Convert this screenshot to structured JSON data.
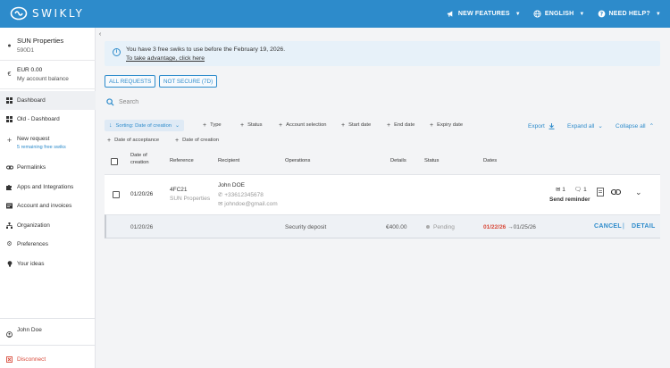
{
  "brand": {
    "name": "SWIKLY",
    "color": "#2d8bcb"
  },
  "topnav": [
    {
      "label": "NEW FEATURES",
      "icon": "megaphone-icon"
    },
    {
      "label": "ENGLISH",
      "icon": "globe-icon"
    },
    {
      "label": "NEED HELP?",
      "icon": "help-icon"
    }
  ],
  "sidebar": {
    "company_name": "SUN Properties",
    "company_code": "590D1",
    "balance_amount": "EUR 0.00",
    "balance_label": "My account balance",
    "items": [
      {
        "label": "Dashboard",
        "icon": "grid-icon",
        "active": true
      },
      {
        "label": "Old - Dashboard",
        "icon": "grid-icon"
      },
      {
        "label": "New request",
        "icon": "plus-icon",
        "sub": "5 remaining free swiks"
      },
      {
        "label": "Permalinks",
        "icon": "link-icon"
      },
      {
        "label": "Apps and Integrations",
        "icon": "puzzle-icon"
      },
      {
        "label": "Account and invoices",
        "icon": "invoice-icon"
      },
      {
        "label": "Organization",
        "icon": "org-chart-icon"
      },
      {
        "label": "Preferences",
        "icon": "gear-icon"
      },
      {
        "label": "Your ideas",
        "icon": "lightbulb-icon"
      }
    ],
    "user_name": "John Doe",
    "logout_label": "Disconnect"
  },
  "banner": {
    "message": "You have 3 free swiks to use before the February 19, 2026.",
    "link": "To take advantage, click here"
  },
  "filters": {
    "all_requests": "ALL REQUESTS",
    "not_secure": "NOT SECURE (7D)"
  },
  "search": {
    "placeholder": "Search"
  },
  "chips": {
    "sorting": "Sorting: Date of creation",
    "type": "Type",
    "status": "Status",
    "account_selection": "Account selection",
    "start_date": "Start date",
    "end_date": "End date",
    "expiry_date": "Expiry date",
    "date_of_acceptance": "Date of acceptance",
    "date_of_creation": "Date of creation"
  },
  "actions": {
    "export": "Export",
    "expand_all": "Expand all",
    "collapse_all": "Collapse all"
  },
  "table": {
    "headers": {
      "date_of_creation_1": "Date of",
      "date_of_creation_2": "creation",
      "reference": "Reference",
      "recipient": "Recipient",
      "operations": "Operations",
      "details": "Details",
      "status": "Status",
      "dates": "Dates"
    },
    "row": {
      "date": "01/20/26",
      "reference": "4FC21",
      "reference_sub": "SUN Properties",
      "recipient_name": "John DOE",
      "recipient_phone": "+33612345678",
      "recipient_email": "johndoe@gmail.com",
      "mail_count": "1",
      "comment_count": "1",
      "send_reminder": "Send reminder"
    },
    "subrow": {
      "date": "01/20/26",
      "operation": "Security deposit",
      "amount": "€400.00",
      "status": "Pending",
      "date_start": "01/22/26",
      "date_end": "01/25/26",
      "cancel": "CANCEL",
      "separator": "|",
      "detail": "DETAIL"
    }
  }
}
